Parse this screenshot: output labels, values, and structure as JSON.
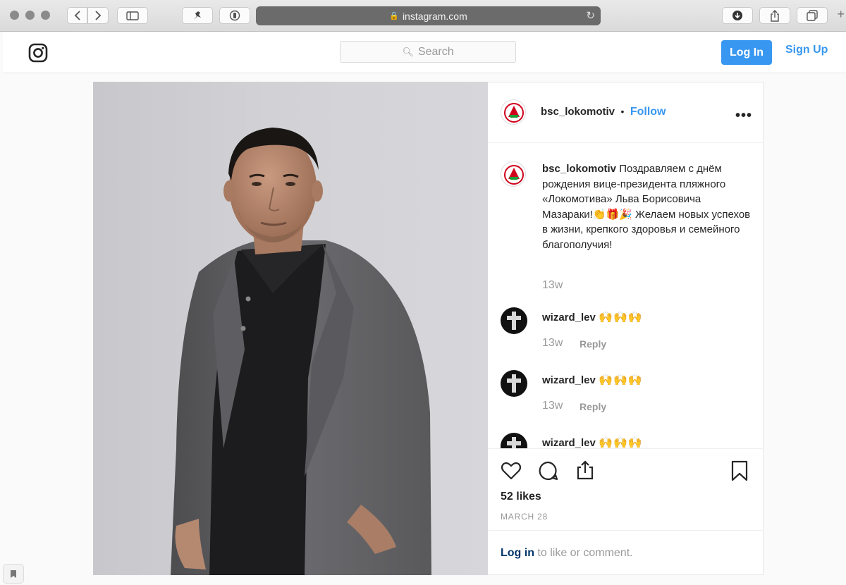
{
  "browser": {
    "url": "instagram.com",
    "icons": [
      "close-dot",
      "minimize-dot",
      "zoom-dot",
      "back-icon",
      "forward-icon",
      "sidebar-icon",
      "extension-icon",
      "reader-icon",
      "lock-icon",
      "reload-icon",
      "download-icon",
      "share-icon",
      "tabs-icon",
      "new-tab-icon"
    ]
  },
  "header": {
    "search_placeholder": "Search",
    "login_label": "Log In",
    "signup_label": "Sign Up"
  },
  "post": {
    "username": "bsc_lokomotiv",
    "bullet": "•",
    "follow_label": "Follow",
    "more_label": "•••",
    "caption_user": "bsc_lokomotiv",
    "caption_text": "Поздравляем с днём рождения вице-президента пляжного «Локомотива» Льва Борисовича Мазараки!👏🎁🎉 Желаем новых успехов в жизни, крепкого здоровья и семейного благополучия!",
    "caption_time": "13w",
    "comments": [
      {
        "user": "wizard_lev",
        "text": "🙌🙌🙌",
        "time": "13w",
        "reply": "Reply"
      },
      {
        "user": "wizard_lev",
        "text": "🙌🙌🙌",
        "time": "13w",
        "reply": "Reply"
      },
      {
        "user": "wizard_lev",
        "text": "🙌🙌🙌"
      }
    ],
    "likes": "52 likes",
    "date": "MARCH 28",
    "login_link": "Log in",
    "login_rest": " to like or comment."
  },
  "colors": {
    "accent": "#3897f0",
    "text": "#262626",
    "muted": "#999999"
  }
}
